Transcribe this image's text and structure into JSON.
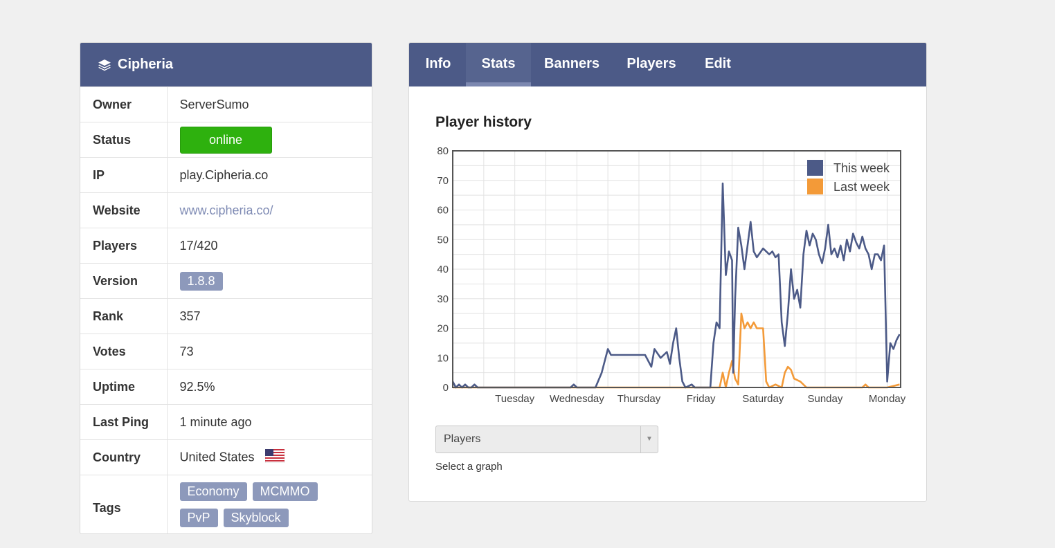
{
  "server": {
    "name": "Cipheria",
    "header_icon": "layers-icon"
  },
  "details": {
    "owner_label": "Owner",
    "owner": "ServerSumo",
    "status_label": "Status",
    "status": "online",
    "status_color": "#2eb10e",
    "ip_label": "IP",
    "ip": "play.Cipheria.co",
    "website_label": "Website",
    "website": "www.cipheria.co/",
    "players_label": "Players",
    "players": "17/420",
    "version_label": "Version",
    "version": "1.8.8",
    "rank_label": "Rank",
    "rank": "357",
    "votes_label": "Votes",
    "votes": "73",
    "uptime_label": "Uptime",
    "uptime": "92.5%",
    "last_ping_label": "Last Ping",
    "last_ping": "1 minute ago",
    "country_label": "Country",
    "country": "United States",
    "country_flag_icon": "us-flag-icon",
    "tags_label": "Tags",
    "tags": [
      "Economy",
      "MCMMO",
      "PvP",
      "Skyblock"
    ]
  },
  "tabs": [
    "Info",
    "Stats",
    "Banners",
    "Players",
    "Edit"
  ],
  "active_tab": "Stats",
  "stats": {
    "title": "Player history",
    "select_value": "Players",
    "select_caption": "Select a graph"
  },
  "colors": {
    "header": "#4c5a87",
    "this_week": "#4c5a87",
    "last_week": "#f39a38",
    "badge": "#8d99bb"
  },
  "chart_data": {
    "type": "line",
    "title": "",
    "xlabel": "",
    "ylabel": "",
    "ylim": [
      0,
      80
    ],
    "yticks": [
      0,
      10,
      20,
      30,
      40,
      50,
      60,
      70,
      80
    ],
    "xlim": [
      0,
      7
    ],
    "x_tick_labels": [
      {
        "x": 1,
        "label": "Tuesday"
      },
      {
        "x": 2,
        "label": "Wednesday"
      },
      {
        "x": 3,
        "label": "Thursday"
      },
      {
        "x": 4,
        "label": "Friday"
      },
      {
        "x": 5,
        "label": "Saturday"
      },
      {
        "x": 6,
        "label": "Sunday"
      },
      {
        "x": 7,
        "label": "Monday"
      }
    ],
    "legend_position": "top-right",
    "grid": true,
    "series": [
      {
        "name": "This week",
        "color": "#4c5a87",
        "points": [
          [
            0,
            2
          ],
          [
            0.05,
            0
          ],
          [
            0.1,
            1
          ],
          [
            0.15,
            0
          ],
          [
            0.2,
            1
          ],
          [
            0.25,
            0
          ],
          [
            0.3,
            0
          ],
          [
            0.35,
            1
          ],
          [
            0.4,
            0
          ],
          [
            1,
            0
          ],
          [
            1.5,
            0
          ],
          [
            1.9,
            0
          ],
          [
            1.95,
            1
          ],
          [
            2.0,
            0
          ],
          [
            2.3,
            0
          ],
          [
            2.4,
            5
          ],
          [
            2.5,
            13
          ],
          [
            2.55,
            11
          ],
          [
            2.7,
            11
          ],
          [
            2.85,
            11
          ],
          [
            3.0,
            11
          ],
          [
            3.1,
            11
          ],
          [
            3.2,
            7
          ],
          [
            3.25,
            13
          ],
          [
            3.35,
            10
          ],
          [
            3.45,
            12
          ],
          [
            3.5,
            8
          ],
          [
            3.55,
            15
          ],
          [
            3.6,
            20
          ],
          [
            3.65,
            10
          ],
          [
            3.7,
            2
          ],
          [
            3.75,
            0
          ],
          [
            3.85,
            1
          ],
          [
            3.9,
            0
          ],
          [
            4.15,
            0
          ],
          [
            4.2,
            15
          ],
          [
            4.25,
            22
          ],
          [
            4.3,
            20
          ],
          [
            4.35,
            69
          ],
          [
            4.4,
            38
          ],
          [
            4.45,
            46
          ],
          [
            4.5,
            43
          ],
          [
            4.52,
            5
          ],
          [
            4.55,
            30
          ],
          [
            4.6,
            54
          ],
          [
            4.65,
            48
          ],
          [
            4.7,
            40
          ],
          [
            4.75,
            48
          ],
          [
            4.8,
            56
          ],
          [
            4.85,
            46
          ],
          [
            4.9,
            44
          ],
          [
            5.0,
            47
          ],
          [
            5.1,
            45
          ],
          [
            5.15,
            46
          ],
          [
            5.2,
            44
          ],
          [
            5.25,
            45
          ],
          [
            5.3,
            22
          ],
          [
            5.35,
            14
          ],
          [
            5.4,
            25
          ],
          [
            5.45,
            40
          ],
          [
            5.5,
            30
          ],
          [
            5.55,
            33
          ],
          [
            5.6,
            27
          ],
          [
            5.65,
            45
          ],
          [
            5.7,
            53
          ],
          [
            5.75,
            48
          ],
          [
            5.8,
            52
          ],
          [
            5.85,
            50
          ],
          [
            5.9,
            45
          ],
          [
            5.95,
            42
          ],
          [
            6.0,
            47
          ],
          [
            6.05,
            55
          ],
          [
            6.1,
            45
          ],
          [
            6.15,
            47
          ],
          [
            6.2,
            44
          ],
          [
            6.25,
            48
          ],
          [
            6.3,
            43
          ],
          [
            6.35,
            50
          ],
          [
            6.4,
            46
          ],
          [
            6.45,
            52
          ],
          [
            6.5,
            49
          ],
          [
            6.55,
            47
          ],
          [
            6.6,
            51
          ],
          [
            6.65,
            47
          ],
          [
            6.7,
            45
          ],
          [
            6.75,
            40
          ],
          [
            6.8,
            45
          ],
          [
            6.85,
            45
          ],
          [
            6.9,
            43
          ],
          [
            6.95,
            48
          ],
          [
            7.0,
            2
          ],
          [
            7.05,
            15
          ],
          [
            7.1,
            13
          ],
          [
            7.15,
            16
          ],
          [
            7.2,
            18
          ]
        ]
      },
      {
        "name": "Last week",
        "color": "#f39a38",
        "points": [
          [
            0,
            0
          ],
          [
            3.3,
            0
          ],
          [
            4.3,
            0
          ],
          [
            4.35,
            5
          ],
          [
            4.4,
            0
          ],
          [
            4.45,
            5
          ],
          [
            4.5,
            9
          ],
          [
            4.55,
            3
          ],
          [
            4.6,
            1
          ],
          [
            4.65,
            25
          ],
          [
            4.7,
            20
          ],
          [
            4.75,
            22
          ],
          [
            4.8,
            20
          ],
          [
            4.85,
            22
          ],
          [
            4.9,
            20
          ],
          [
            5.0,
            20
          ],
          [
            5.05,
            2
          ],
          [
            5.1,
            0
          ],
          [
            5.2,
            1
          ],
          [
            5.3,
            0
          ],
          [
            5.35,
            5
          ],
          [
            5.4,
            7
          ],
          [
            5.45,
            6
          ],
          [
            5.5,
            3
          ],
          [
            5.6,
            2
          ],
          [
            5.7,
            0
          ],
          [
            5.8,
            0
          ],
          [
            6.5,
            0
          ],
          [
            6.6,
            0
          ],
          [
            6.65,
            1
          ],
          [
            6.7,
            0
          ],
          [
            7.0,
            0
          ],
          [
            7.2,
            1
          ]
        ]
      }
    ]
  }
}
